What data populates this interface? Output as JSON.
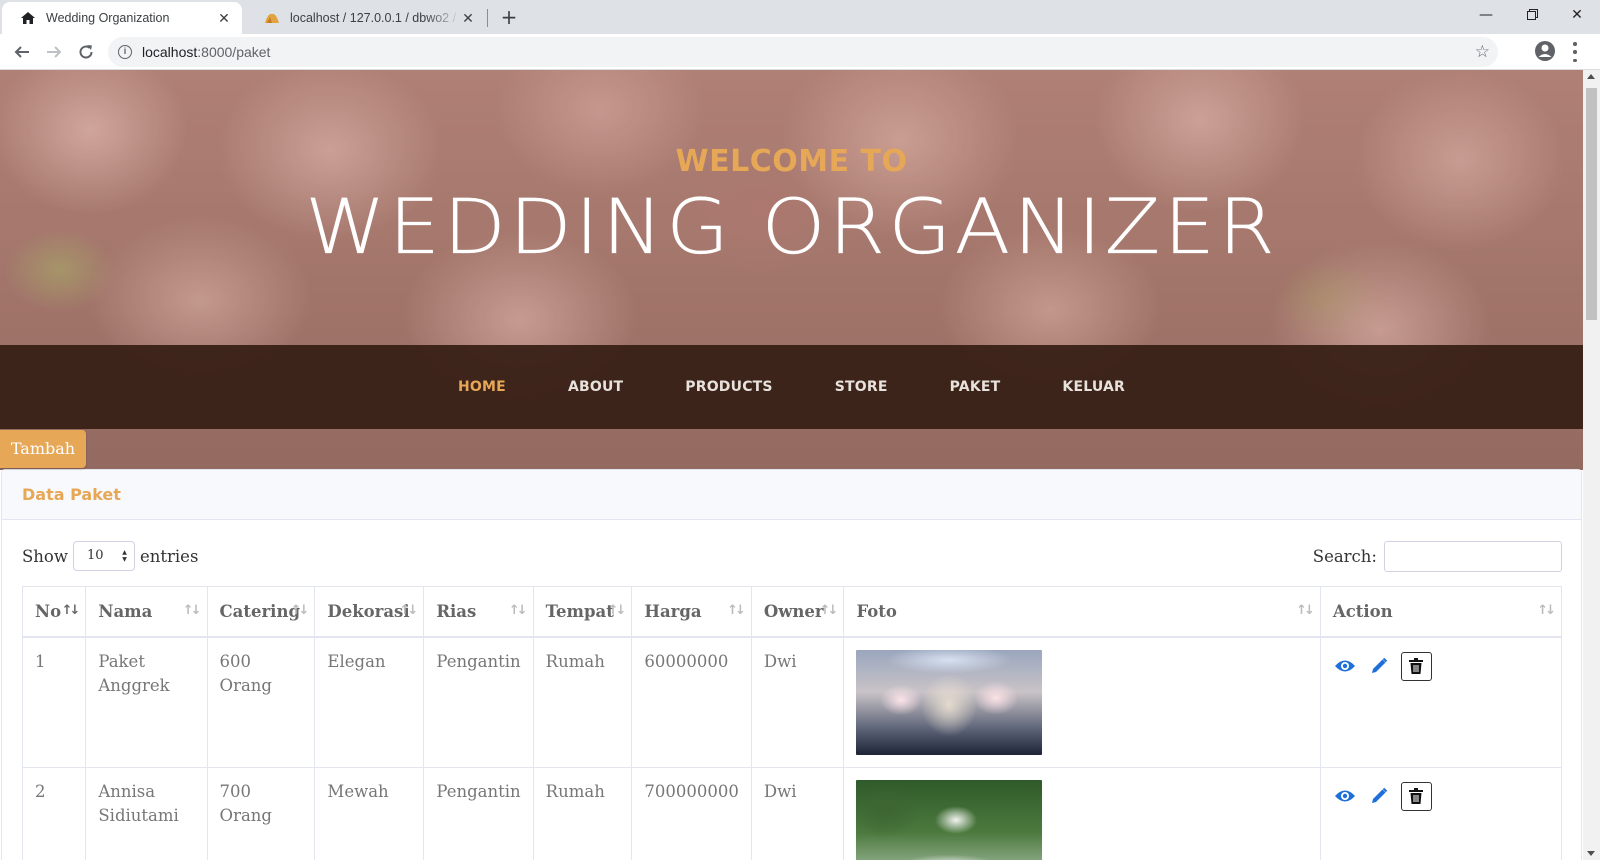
{
  "browser": {
    "tabs": [
      {
        "title": "Wedding Organization",
        "active": true,
        "favicon": "home-icon"
      },
      {
        "title": "localhost / 127.0.0.1 / dbwo2 / cu",
        "active": false,
        "favicon": "phpmyadmin-icon"
      }
    ],
    "url_host": "localhost",
    "url_rest": ":8000/paket"
  },
  "hero": {
    "welcome": "WELCOME TO",
    "title": "WEDDING ORGANIZER"
  },
  "nav": {
    "items": [
      "HOME",
      "ABOUT",
      "PRODUCTS",
      "STORE",
      "PAKET",
      "KELUAR"
    ],
    "active": "HOME"
  },
  "add_button": "Tambah",
  "card": {
    "title": "Data Paket",
    "show_label": "Show",
    "entries_value": "10",
    "entries_label": "entries",
    "search_label": "Search:"
  },
  "table": {
    "columns": [
      "No",
      "Nama",
      "Catering",
      "Dekorasi",
      "Rias",
      "Tempat",
      "Harga",
      "Owner",
      "Foto",
      "Action"
    ],
    "rows": [
      {
        "no": "1",
        "nama": "Paket Anggrek",
        "catering": "600 Orang",
        "dekorasi": "Elegan",
        "rias": "Pengantin",
        "tempat": "Rumah",
        "harga": "60000000",
        "owner": "Dwi"
      },
      {
        "no": "2",
        "nama": "Annisa Sidiutami",
        "catering": "700 Orang",
        "dekorasi": "Mewah",
        "rias": "Pengantin",
        "tempat": "Rumah",
        "harga": "700000000",
        "owner": "Dwi"
      }
    ]
  },
  "colors": {
    "accent": "#e6a756",
    "nav_bg": "#361e14",
    "action_blue": "#1e6fd9"
  }
}
